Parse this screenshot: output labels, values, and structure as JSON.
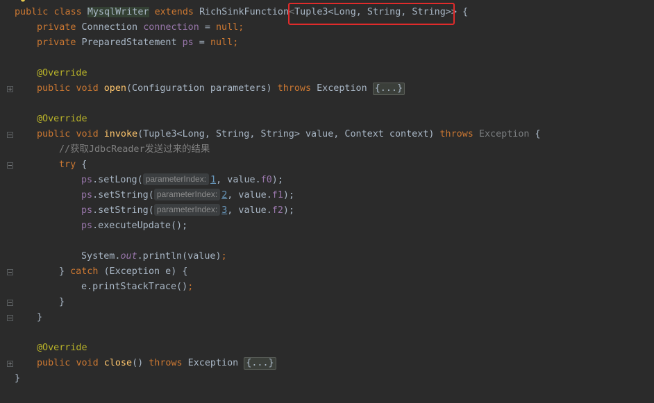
{
  "lines": {
    "l1": {
      "public": "public",
      "class": "class",
      "name": "MysqlWriter",
      "extends": "extends",
      "parent": "RichSinkFunction",
      "lt": "<",
      "generic": "Tuple3<Long, String, String>>",
      "brace": " {"
    },
    "l2": {
      "mod": "private",
      "type": "Connection",
      "field": "connection",
      "eq": " = ",
      "nul": "null",
      "semi": ";"
    },
    "l3": {
      "mod": "private",
      "type": "PreparedStatement",
      "field": "ps",
      "eq": " = ",
      "nul": "null",
      "semi": ";"
    },
    "l5": {
      "ann": "@Override"
    },
    "l6": {
      "public": "public",
      "void": "void",
      "fn": "open",
      "args": "(Configuration parameters) ",
      "throws": "throws",
      "exc": " Exception ",
      "fold": "{...}"
    },
    "l8": {
      "ann": "@Override"
    },
    "l9": {
      "public": "public",
      "void": "void",
      "fn": "invoke",
      "args": "(Tuple3<Long, String, String> value, Context context) ",
      "throws": "throws",
      "exc": " Exception",
      "brace": " {"
    },
    "l10": {
      "comment": "//获取JdbcReader发送过来的结果"
    },
    "l11": {
      "try": "try",
      "brace": " {"
    },
    "l12": {
      "obj": "ps",
      "call": ".setLong(",
      "hint": "parameterIndex:",
      "num": "1",
      "rest": ", value.",
      "f": "f0",
      "end": ");"
    },
    "l13": {
      "obj": "ps",
      "call": ".setString(",
      "hint": "parameterIndex:",
      "num": "2",
      "rest": ", value.",
      "f": "f1",
      "end": ");"
    },
    "l14": {
      "obj": "ps",
      "call": ".setString(",
      "hint": "parameterIndex:",
      "num": "3",
      "rest": ", value.",
      "f": "f2",
      "end": ");"
    },
    "l15": {
      "obj": "ps",
      "call": ".executeUpdate();"
    },
    "l17": {
      "sys": "System.",
      "out": "out",
      "call": ".println(value)",
      "semi": ";"
    },
    "l18": {
      "close": "} ",
      "catch": "catch",
      "rest": " (Exception e) {"
    },
    "l19": {
      "text": "e.printStackTrace()",
      "semi": ";"
    },
    "l20": {
      "text": "}"
    },
    "l21": {
      "text": "}"
    },
    "l23": {
      "ann": "@Override"
    },
    "l24": {
      "public": "public",
      "void": "void",
      "fn": "close",
      "args": "() ",
      "throws": "throws",
      "exc": " Exception ",
      "fold": "{...}"
    },
    "l25": {
      "text": "}"
    }
  },
  "colors": {
    "background": "#2b2b2b",
    "keyword": "#cc7832",
    "field": "#9876aa",
    "method": "#ffc66d",
    "annotation": "#bbb529",
    "comment": "#808080",
    "number": "#6897bb",
    "highlight_box": "#e02b2b"
  },
  "icons": {
    "bulb": "lightbulb-icon",
    "fold": "fold-marker-icon"
  }
}
